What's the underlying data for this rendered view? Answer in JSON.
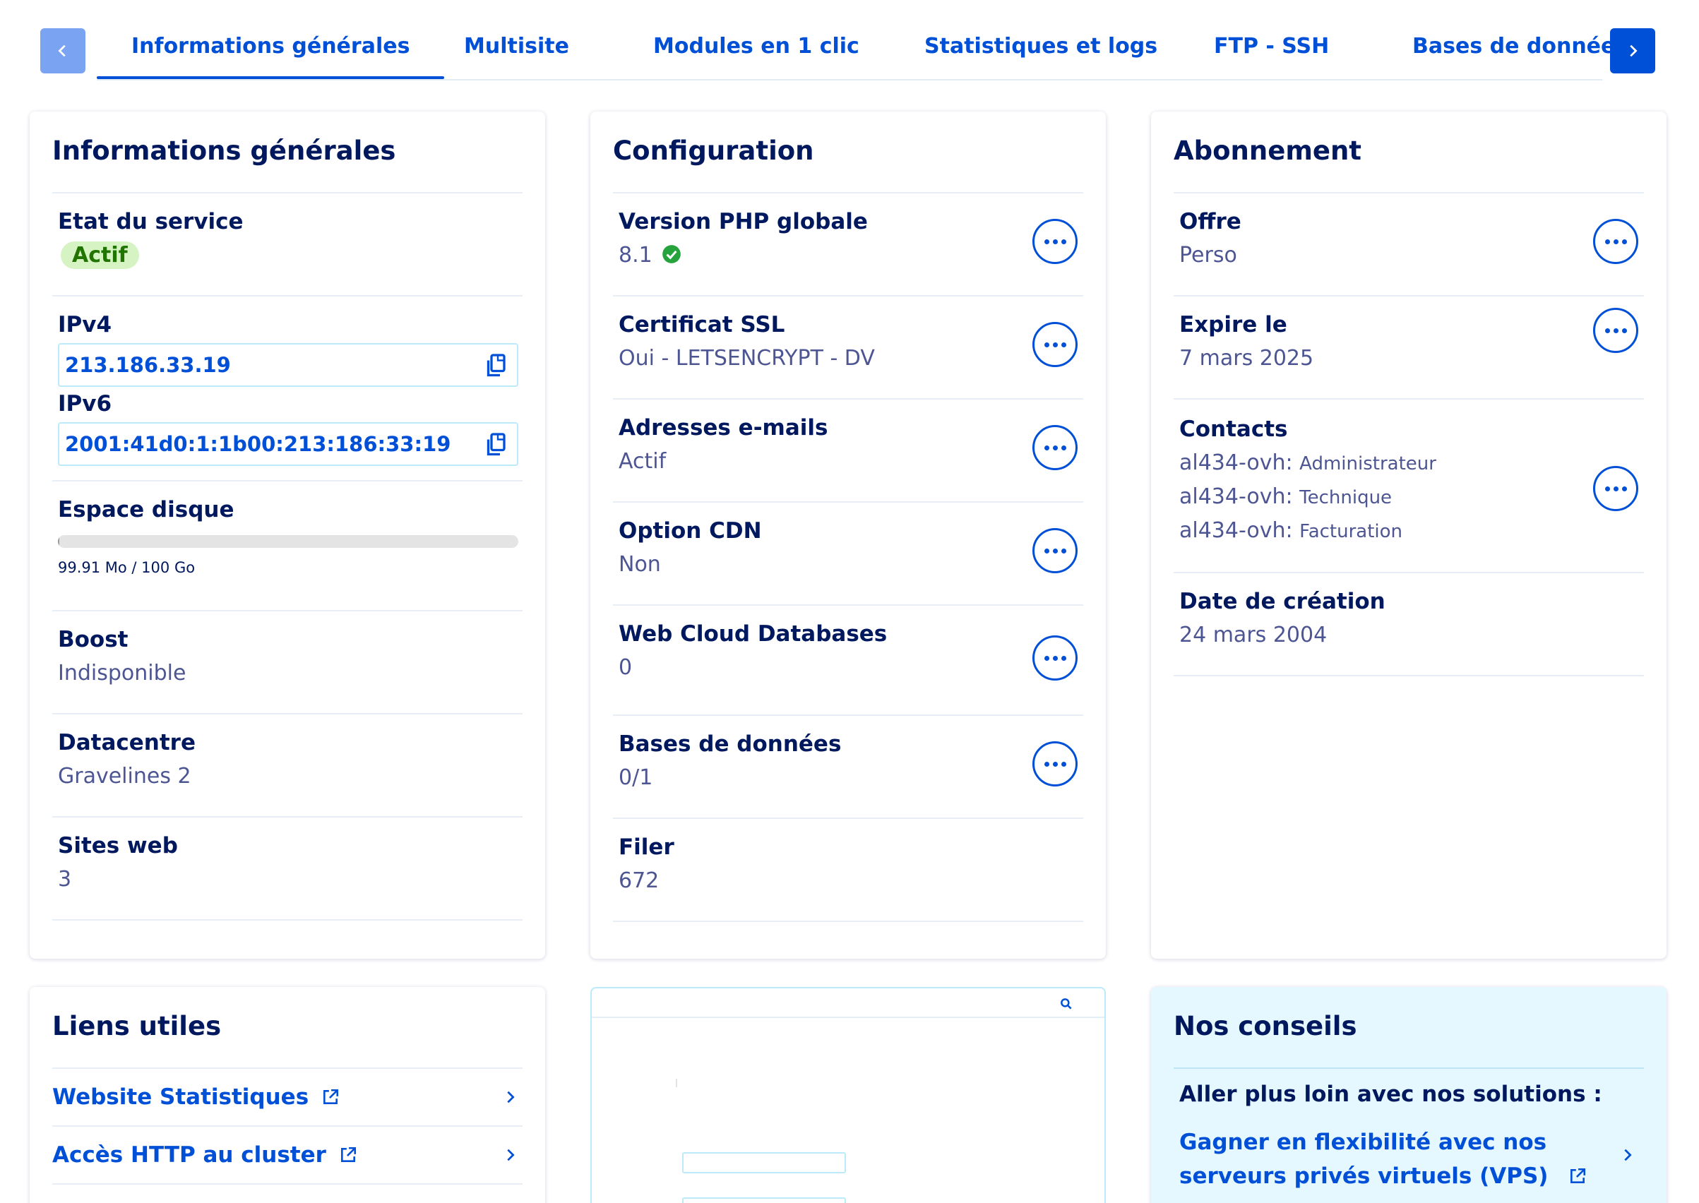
{
  "tabs": [
    {
      "label": "Informations générales",
      "active": true
    },
    {
      "label": "Multisite"
    },
    {
      "label": "Modules en 1 clic"
    },
    {
      "label": "Statistiques et logs"
    },
    {
      "label": "FTP - SSH"
    },
    {
      "label": "Bases de données"
    }
  ],
  "icons": {
    "prev": "chevron-left-icon",
    "next": "chevron-right-icon",
    "copy": "copy-icon",
    "more": "more-icon",
    "check": "check-circle-icon",
    "external": "external-link-icon",
    "chevron": "chevron-right-icon",
    "search": "search-icon"
  },
  "colors": {
    "primary": "#0050d7",
    "title": "#00185e",
    "muted": "#4d5693",
    "success": "#227400",
    "success_bg": "#d6f3c4",
    "advice_bg": "#e5f7ff"
  },
  "general": {
    "title": "Informations générales",
    "service_state_label": "Etat du service",
    "service_state_value": "Actif",
    "ipv4_label": "IPv4",
    "ipv4_value": "213.186.33.19",
    "ipv6_label": "IPv6",
    "ipv6_value": "2001:41d0:1:1b00:213:186:33:19",
    "disk_label": "Espace disque",
    "disk_usage_fraction": 0.001,
    "disk_usage_text": "99.91 Mo / 100 Go",
    "boost_label": "Boost",
    "boost_value": "Indisponible",
    "datacenter_label": "Datacentre",
    "datacenter_value": "Gravelines 2",
    "websites_label": "Sites web",
    "websites_value": "3"
  },
  "configuration": {
    "title": "Configuration",
    "php_label": "Version PHP globale",
    "php_value": "8.1",
    "ssl_label": "Certificat SSL",
    "ssl_value": "Oui - LETSENCRYPT - DV",
    "email_label": "Adresses e-mails",
    "email_value": "Actif",
    "cdn_label": "Option CDN",
    "cdn_value": "Non",
    "webcloud_label": "Web Cloud Databases",
    "webcloud_value": "0",
    "databases_label": "Bases de données",
    "databases_value": "0/1",
    "filer_label": "Filer",
    "filer_value": "672"
  },
  "subscription": {
    "title": "Abonnement",
    "offer_label": "Offre",
    "offer_value": "Perso",
    "expires_label": "Expire le",
    "expires_value": "7 mars 2025",
    "contacts_label": "Contacts",
    "contacts": [
      {
        "user": "al434-ovh:",
        "role": "Administrateur"
      },
      {
        "user": "al434-ovh:",
        "role": "Technique"
      },
      {
        "user": "al434-ovh:",
        "role": "Facturation"
      }
    ],
    "created_label": "Date de création",
    "created_value": "24 mars 2004"
  },
  "useful_links": {
    "title": "Liens utiles",
    "items": [
      {
        "label": "Website Statistiques"
      },
      {
        "label": "Accès HTTP au cluster"
      }
    ]
  },
  "advice": {
    "title": "Nos conseils",
    "heading": "Aller plus loin avec nos solutions :",
    "link": "Gagner en flexibilité avec nos serveurs privés virtuels (VPS)"
  }
}
